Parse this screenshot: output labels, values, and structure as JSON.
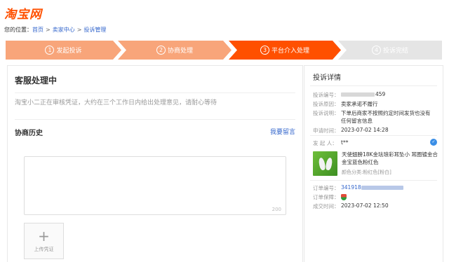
{
  "logo": "淘宝网",
  "breadcrumb": {
    "prefix": "您的位置：",
    "items": [
      "首页",
      "卖家中心",
      "投诉管理"
    ],
    "separator": ">"
  },
  "steps": [
    {
      "num": "1",
      "label": "发起投诉",
      "state": "done"
    },
    {
      "num": "2",
      "label": "协商处理",
      "state": "done"
    },
    {
      "num": "3",
      "label": "平台介入处理",
      "state": "active"
    },
    {
      "num": "4",
      "label": "投诉完结",
      "state": "pending"
    }
  ],
  "main": {
    "title": "客服处理中",
    "status_text": "淘宝小二正在审核凭证，大约在三个工作日内给出处理意见，请耐心等待",
    "history_title": "协商历史",
    "leave_message": "我要留言",
    "textarea_counter": "200",
    "upload_label": "上传凭证"
  },
  "side": {
    "title": "投诉详情",
    "complaint_no_label": "投诉编号：",
    "complaint_no_suffix": "459",
    "reason_label": "投诉原因：",
    "reason": "卖家承诺不履行",
    "desc_label": "投诉说明：",
    "desc_line1": "下单后商家不按照约定时间发货也没有",
    "desc_line2": "任何留言信息",
    "apply_time_label": "申请时间：",
    "apply_time": "2023-07-02 14:28",
    "initiator_label": "发 起 人：",
    "initiator": "t**",
    "product_title": "天使翅膀18K金珐琅彩耳坠小 耳圈镀金合金宝蓝色粉红色",
    "product_sku": "颜色分类:粉红色[粉白]",
    "order_no_label": "订单编号：",
    "order_no_prefix": "341918",
    "order_protect_label": "订单保障：",
    "deal_time_label": "成交时间：",
    "deal_time": "2023-07-02 12:50"
  },
  "colors": {
    "brand": "#ff5000",
    "step_done": "#f8a57a",
    "step_pending": "#e5e5e5",
    "link": "#3366cc"
  }
}
